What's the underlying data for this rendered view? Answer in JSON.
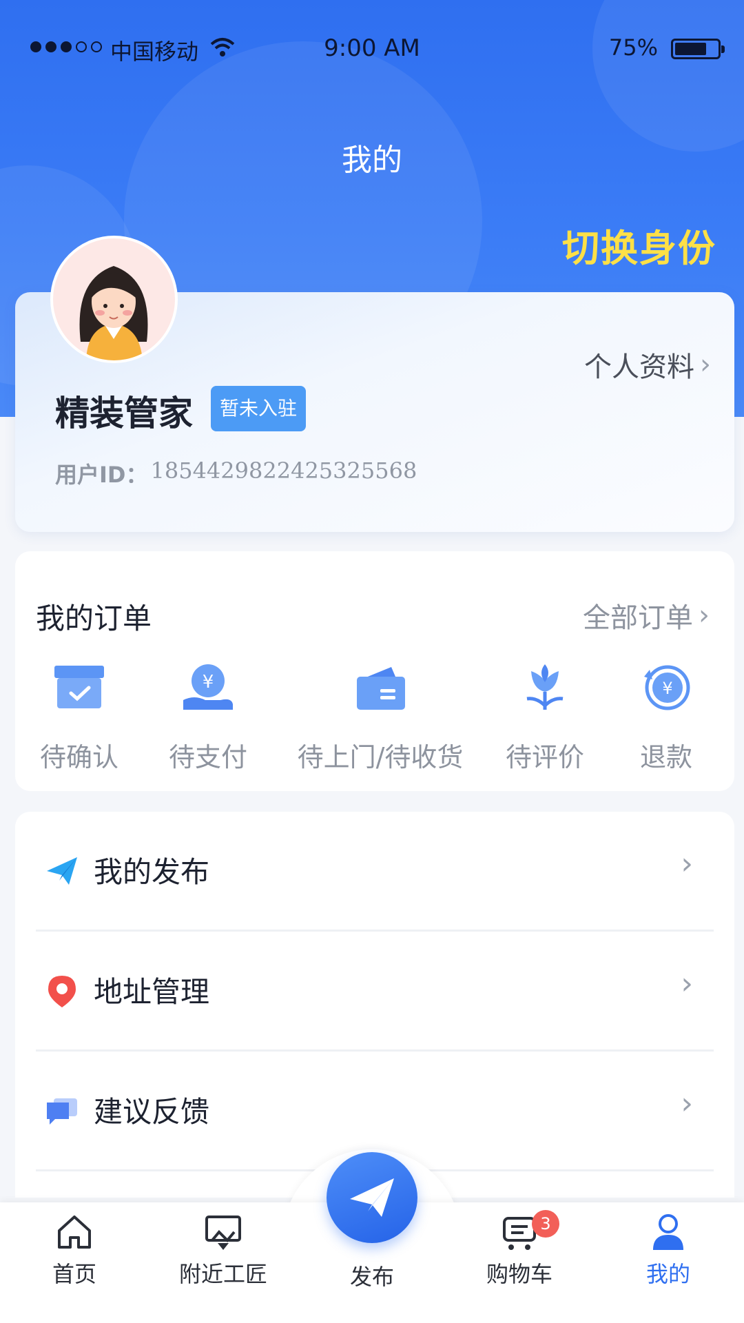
{
  "status_bar": {
    "carrier": "中国移动",
    "time": "9:00 AM",
    "battery": "75%",
    "battery_level": 0.75
  },
  "header": {
    "title": "我的",
    "switch_identity": "切换身份"
  },
  "profile": {
    "link_label": "个人资料",
    "name": "精装管家",
    "badge": "暂未入驻",
    "id_label": "用户ID：",
    "id_value": "1854429822425325568"
  },
  "orders": {
    "title": "我的订单",
    "all_label": "全部订单",
    "items": [
      {
        "label": "待确认",
        "icon": "box-check-icon"
      },
      {
        "label": "待支付",
        "icon": "coin-hand-icon"
      },
      {
        "label": "待上门/待收货",
        "icon": "wallet-icon"
      },
      {
        "label": "待评价",
        "icon": "flower-icon"
      },
      {
        "label": "退款",
        "icon": "refund-icon"
      }
    ]
  },
  "menu": [
    {
      "label": "我的发布",
      "icon": "paper-plane-icon"
    },
    {
      "label": "地址管理",
      "icon": "location-pin-icon"
    },
    {
      "label": "建议反馈",
      "icon": "chat-bubble-icon"
    }
  ],
  "tabs": [
    {
      "label": "首页",
      "icon": "home-icon"
    },
    {
      "label": "附近工匠",
      "icon": "map-icon"
    },
    {
      "label": "发布",
      "icon": "paper-plane-icon"
    },
    {
      "label": "购物车",
      "icon": "cart-icon",
      "badge": "3"
    },
    {
      "label": "我的",
      "icon": "person-icon",
      "active": true
    }
  ],
  "colors": {
    "primary": "#2f6ff0",
    "accent_yellow": "#fde047",
    "badge_blue": "#4c9bf5",
    "badge_red": "#f25f58"
  }
}
